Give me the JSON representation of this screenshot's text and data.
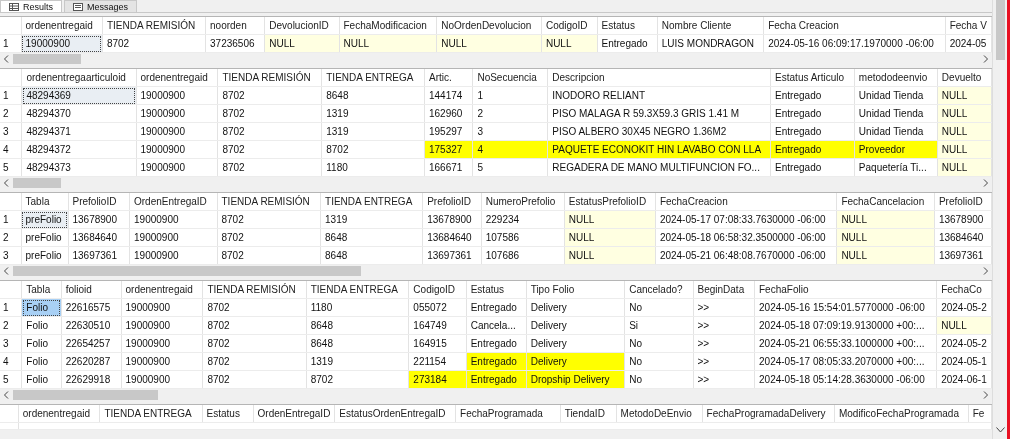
{
  "tabs": [
    {
      "label": "Results",
      "selected": true
    },
    {
      "label": "Messages",
      "selected": false
    }
  ],
  "grids": [
    {
      "columns": [
        "ordenentregaid",
        "TIENDA REMISIÓN",
        "noorden",
        "DevolucionID",
        "FechaModificacion",
        "NoOrdenDevolucion",
        "CodigoID",
        "Estatus",
        "Nombre Cliente",
        "Fecha Creacion",
        "Fecha V"
      ],
      "rows": [
        {
          "number": "1",
          "cells": [
            {
              "text": "19000900",
              "focused": true
            },
            "8702",
            "37236506",
            {
              "text": "NULL",
              "null": true
            },
            {
              "text": "NULL",
              "null": true
            },
            {
              "text": "NULL",
              "null": true
            },
            {
              "text": "NULL",
              "null": true
            },
            "Entregado",
            "LUIS MONDRAGON",
            "2024-05-16 06:09:17.1970000 -06:00",
            "2024-05"
          ]
        }
      ]
    },
    {
      "columns": [
        "ordenentregaarticuloid",
        "ordenentregaid",
        "TIENDA REMISIÓN",
        "TIENDA ENTREGA",
        "Artic.",
        "NoSecuencia",
        "Descripcion",
        "Estatus Articulo",
        "metododeenvio",
        "Devuelto"
      ],
      "rows": [
        {
          "number": "1",
          "cells": [
            {
              "text": "48294369",
              "focused": true
            },
            "19000900",
            "8702",
            "8648",
            "144174",
            "1",
            "INODORO RELIANT",
            "Entregado",
            "Unidad Tienda",
            {
              "text": "NULL",
              "null": true
            }
          ]
        },
        {
          "number": "2",
          "cells": [
            "48294370",
            "19000900",
            "8702",
            "1319",
            "162960",
            "2",
            "PISO MALAGA R 59.3X59.3 GRIS 1.41 M",
            "Entregado",
            "Unidad Tienda",
            {
              "text": "NULL",
              "null": true
            }
          ]
        },
        {
          "number": "3",
          "cells": [
            "48294371",
            "19000900",
            "8702",
            "1319",
            "195297",
            "3",
            "PISO ALBERO 30X45 NEGRO 1.36M2",
            "Entregado",
            "Unidad Tienda",
            {
              "text": "NULL",
              "null": true
            }
          ]
        },
        {
          "number": "4",
          "cells": [
            "48294372",
            "19000900",
            "8702",
            "8702",
            {
              "text": "175327",
              "marked": true
            },
            {
              "text": "4",
              "marked": true
            },
            {
              "text": "PAQUETE ECONOKIT HIN LAVABO CON LLA",
              "marked": true
            },
            {
              "text": "Entregado",
              "marked": true
            },
            {
              "text": "Proveedor",
              "marked": true
            },
            {
              "text": "NULL",
              "null": true
            }
          ]
        },
        {
          "number": "5",
          "cells": [
            "48294373",
            "19000900",
            "8702",
            "1180",
            "166671",
            "5",
            "REGADERA DE MANO MULTIFUNCION FO...",
            "Entregado",
            "Paquetería Ti...",
            {
              "text": "NULL",
              "null": true
            }
          ]
        }
      ]
    },
    {
      "columns": [
        "Tabla",
        "PrefolioID",
        "OrdenEntregaID",
        "TIENDA REMISIÓN",
        "TIENDA ENTREGA",
        "PrefolioID",
        "NumeroPrefolio",
        "EstatusPrefolioID",
        "FechaCreacion",
        "FechaCancelacion",
        "PrefolioID"
      ],
      "rows": [
        {
          "number": "1",
          "cells": [
            {
              "text": "preFolio",
              "focused": true
            },
            "13678900",
            "19000900",
            "8702",
            "1319",
            "13678900",
            "229234",
            {
              "text": "NULL",
              "null": true
            },
            "2024-05-17 07:08:33.7630000 -06:00",
            {
              "text": "NULL",
              "null": true
            },
            "13678900"
          ]
        },
        {
          "number": "2",
          "cells": [
            "preFolio",
            "13684640",
            "19000900",
            "8702",
            "8648",
            "13684640",
            "107586",
            {
              "text": "NULL",
              "null": true
            },
            "2024-05-18 06:58:32.3500000 -06:00",
            {
              "text": "NULL",
              "null": true
            },
            "13684640"
          ]
        },
        {
          "number": "3",
          "cells": [
            "preFolio",
            "13697361",
            "19000900",
            "8702",
            "8648",
            "13697361",
            "107686",
            {
              "text": "NULL",
              "null": true
            },
            "2024-05-21 06:48:08.7670000 -06:00",
            {
              "text": "NULL",
              "null": true
            },
            "13697361"
          ]
        }
      ]
    },
    {
      "columns": [
        "Tabla",
        "folioid",
        "ordenentregaid",
        "TIENDA REMISIÓN",
        "TIENDA ENTREGA",
        "CodigoID",
        "Estatus",
        "Tipo Folio",
        "Cancelado?",
        "BeginData",
        "FechaFolio",
        "FechaCo"
      ],
      "rows": [
        {
          "number": "1",
          "cells": [
            {
              "text": "Folio",
              "focused": true,
              "selected": true
            },
            "22616575",
            "19000900",
            "8702",
            "1180",
            "055072",
            "Entregado",
            "Delivery",
            "No",
            ">>",
            "2024-05-16 15:54:01.5770000 -06:00",
            "2024-05-2"
          ]
        },
        {
          "number": "2",
          "cells": [
            "Folio",
            "22630510",
            "19000900",
            "8702",
            "8648",
            "164749",
            "Cancela...",
            "Delivery",
            "Si",
            ">>",
            "2024-05-18 07:09:19.9130000 +00:...",
            {
              "text": "NULL",
              "null": true
            }
          ]
        },
        {
          "number": "3",
          "cells": [
            "Folio",
            "22654257",
            "19000900",
            "8702",
            "8648",
            "164915",
            "Entregado",
            "Delivery",
            "No",
            ">>",
            "2024-05-21 06:55:33.1000000 +00:...",
            "2024-05-2"
          ]
        },
        {
          "number": "4",
          "cells": [
            "Folio",
            "22620287",
            "19000900",
            "8702",
            "1319",
            "221154",
            {
              "text": "Entregado",
              "marked": true
            },
            {
              "text": "Delivery",
              "marked": true
            },
            "No",
            ">>",
            "2024-05-17 08:05:33.2070000 +00:...",
            "2024-05-1"
          ]
        },
        {
          "number": "5",
          "cells": [
            "Folio",
            "22629918",
            "19000900",
            "8702",
            "8702",
            {
              "text": "273184",
              "marked": true
            },
            {
              "text": "Entregado",
              "marked": true
            },
            {
              "text": "Dropship Delivery",
              "marked": true
            },
            "No",
            ">>",
            "2024-05-18 05:14:28.3630000 -06:00",
            "2024-06-1"
          ]
        }
      ]
    },
    {
      "columns": [
        "ordenentregaid",
        "TIENDA ENTREGA",
        "Estatus",
        "OrdenEntregaID",
        "EstatusOrdenEntregaID",
        "FechaProgramada",
        "TiendaID",
        "MetodoDeEnvio",
        "FechaProgramadaDelivery",
        "ModificoFechaProgramada",
        "Fe"
      ]
    }
  ]
}
